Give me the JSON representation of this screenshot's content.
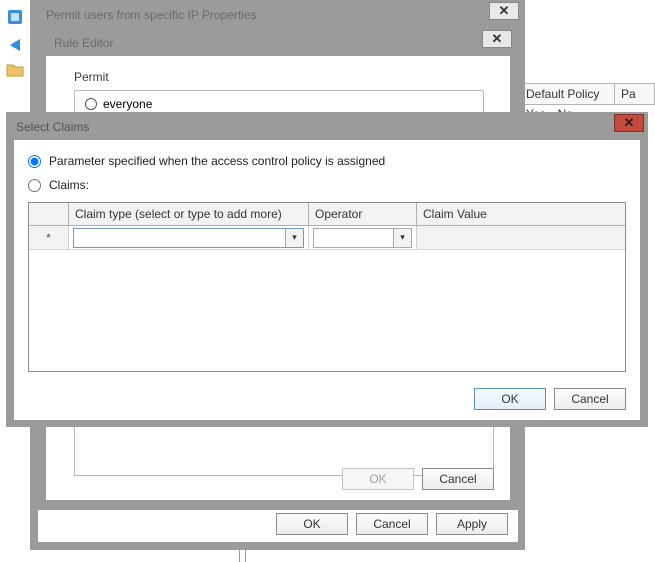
{
  "app": {
    "right_grid": {
      "col1": "Default Policy",
      "col2": "Pa",
      "val1": "Yes",
      "val2": "No"
    }
  },
  "properties": {
    "title": "Permit users from specific IP Properties",
    "ok_label": "OK",
    "cancel_label": "Cancel",
    "apply_label": "Apply"
  },
  "rule_editor": {
    "title": "Rule Editor",
    "permit_heading": "Permit",
    "everyone_label": "everyone",
    "ok_label": "OK",
    "cancel_label": "Cancel"
  },
  "select_claims": {
    "title": "Select Claims",
    "radio_parameter": "Parameter specified when the access control policy is assigned",
    "radio_claims": "Claims:",
    "selected_radio": "parameter",
    "table": {
      "col_type": "Claim type (select or type to add more)",
      "col_operator": "Operator",
      "col_value": "Claim Value",
      "row_marker": "*",
      "claim_type_value": "",
      "operator_value": "",
      "claim_value": ""
    },
    "ok_label": "OK",
    "cancel_label": "Cancel"
  }
}
